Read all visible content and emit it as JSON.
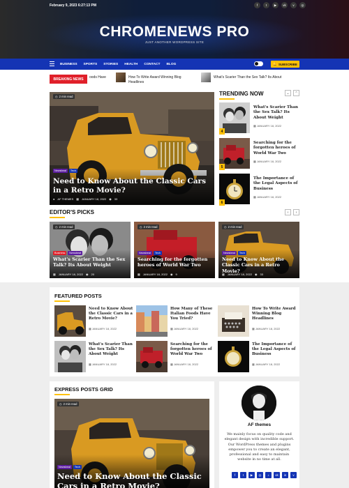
{
  "header": {
    "date": "February 9, 2023 6:27:13 PM",
    "logo": "CHROMENEWS PRO",
    "tagline": "JUST ANOTHER WORDPRESS SITE",
    "social_icons": [
      "facebook-icon",
      "twitter-icon",
      "youtube-icon",
      "vk-icon",
      "vimeo-icon",
      "instagram-icon"
    ]
  },
  "nav": {
    "items": [
      "BUSINESS",
      "SPORTS",
      "STORIES",
      "HEALTH",
      "CONTACT",
      "BLOG"
    ],
    "subscribe": "SUBSCRIBE"
  },
  "breaking": {
    "label": "BREAKING NEWS",
    "items": [
      "oods Have",
      "How To Write Award Winning Blog Headlines",
      "What's Scarier Than the Sex Talk? Its About"
    ]
  },
  "hero": {
    "read_time": "2 min read",
    "categories": [
      "Newsbeat",
      "Tech"
    ],
    "title": "Need to Know About the Classic Cars in a Retro Movie?",
    "author": "AF THEMES",
    "date": "JANUARY 18, 2022",
    "views": "33"
  },
  "trending": {
    "heading": "TRENDING NOW",
    "items": [
      {
        "num": "4",
        "title": "What's Scarier Than the Sex Talk? Its About Weight",
        "date": "JANUARY 18, 2022"
      },
      {
        "num": "5",
        "title": "Searching for the forgotten heroes of World War Two",
        "date": "JANUARY 18, 2022"
      },
      {
        "num": "6",
        "title": "The Importance of the Legal Aspects of Business",
        "date": "JANUARY 18, 2022"
      }
    ]
  },
  "editors": {
    "heading": "EDITOR'S PICKS",
    "items": [
      {
        "read": "2 min read",
        "cats": [
          "Business",
          "Newsbeat"
        ],
        "title": "What's Scarier Than the Sex Talk? Its About Weight",
        "date": "JANUARY 18, 2022",
        "views": "20"
      },
      {
        "read": "2 min read",
        "cats": [
          "Newsbeat",
          "Tech"
        ],
        "title": "Searching for the forgotten heroes of World War Two",
        "date": "JANUARY 18, 2022",
        "views": "9"
      },
      {
        "read": "2 min read",
        "cats": [
          "Newsbeat",
          "Tech"
        ],
        "title": "Need to Know About the Classic Cars in a Retro Movie?",
        "date": "JANUARY 18, 2022",
        "views": "33"
      }
    ]
  },
  "featured": {
    "heading": "FEATURED POSTS",
    "items": [
      {
        "title": "Need to Know About the Classic Cars in a Retro Movie?",
        "date": "JANUARY 18, 2022"
      },
      {
        "title": "How Many of These Italian Foods Have You Tried?",
        "date": "JANUARY 18, 2022"
      },
      {
        "title": "How To Write Award Winning Blog Headlines",
        "date": "JANUARY 18, 2022"
      },
      {
        "title": "What's Scarier Than the Sex Talk? Its About Weight",
        "date": "JANUARY 18, 2022"
      },
      {
        "title": "Searching for the forgotten heroes of World War Two",
        "date": "JANUARY 18, 2022"
      },
      {
        "title": "The Importance of the Legal Aspects of Business",
        "date": "JANUARY 18, 2022"
      }
    ]
  },
  "express": {
    "heading": "EXPRESS POSTS GRID",
    "read_time": "2 min read",
    "categories": [
      "Newsbeat",
      "Tech"
    ],
    "title": "Need to Know About the Classic Cars in a Retro Movie?"
  },
  "author": {
    "name": "AF themes",
    "description": "We mainly focus on quality code and elegant design with incredible support. Our WordPress themes and plugins empower you to create an elegant, professional and easy to maintain website in no time at all.",
    "social_icons": [
      "facebook-icon",
      "twitter-icon",
      "youtube-icon",
      "instagram-icon",
      "tiktok-icon",
      "vk-icon",
      "linkedin-icon",
      "vimeo-icon"
    ]
  },
  "colors": {
    "accent": "#ffc107",
    "nav": "#1434b4",
    "breaking": "#e0202a"
  }
}
